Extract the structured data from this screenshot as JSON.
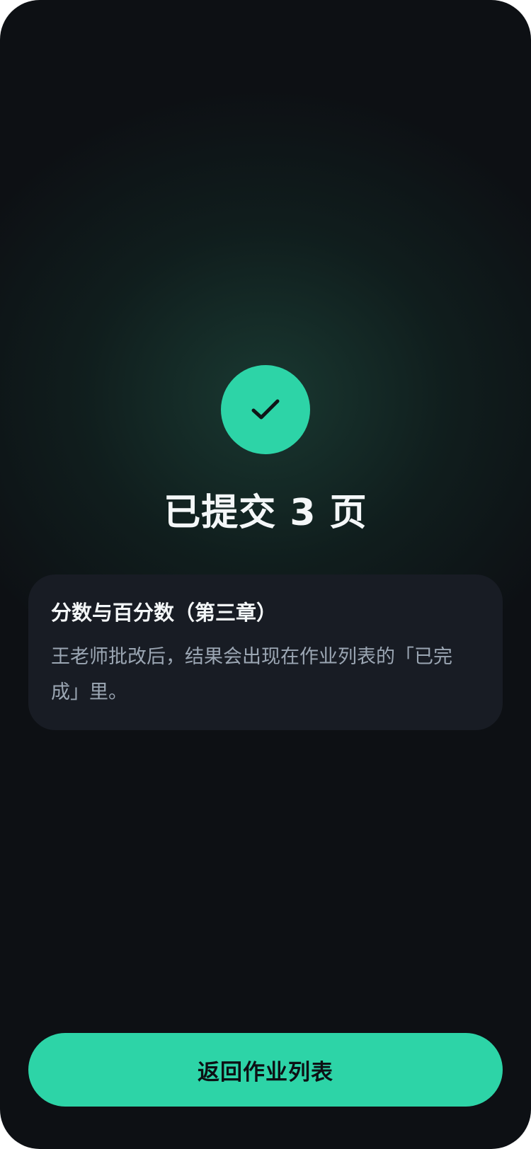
{
  "status": {
    "icon": "check-icon",
    "title": "已提交 3 页",
    "accent_color": "#2dd4a7"
  },
  "assignment": {
    "title": "分数与百分数（第三章）",
    "message": "王老师批改后，结果会出现在作业列表的「已完成」里。"
  },
  "actions": {
    "return_label": "返回作业列表"
  }
}
